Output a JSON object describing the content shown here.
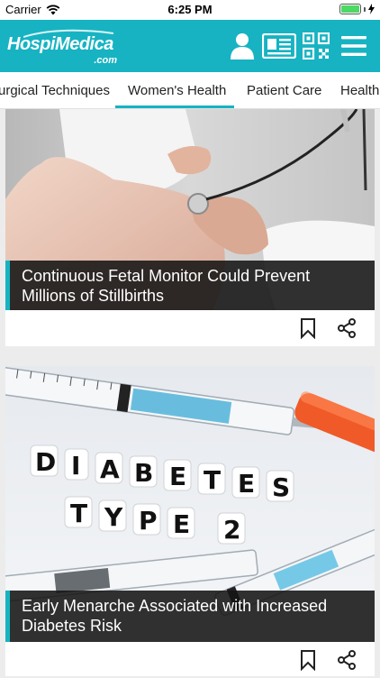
{
  "status": {
    "carrier": "Carrier",
    "time": "6:25 PM"
  },
  "header": {
    "logo_brand": "HospiMedica",
    "logo_domain": ".com",
    "icons": [
      "user-icon",
      "newspaper-icon",
      "qr-code-icon",
      "menu-icon"
    ],
    "accent_color": "#17b3c2"
  },
  "tabs": {
    "items": [
      {
        "label": "urgical Techniques"
      },
      {
        "label": "Women's Health"
      },
      {
        "label": "Patient Care"
      },
      {
        "label": "Health"
      }
    ],
    "active_index": 1
  },
  "articles": [
    {
      "title": "Continuous Fetal Monitor Could Prevent Millions of Stillbirths"
    },
    {
      "title": "Early Menarche Associated with Increased Diabetes Risk",
      "image_text_line1": "DIABETES",
      "image_text_line2": "TYPE 2"
    }
  ]
}
